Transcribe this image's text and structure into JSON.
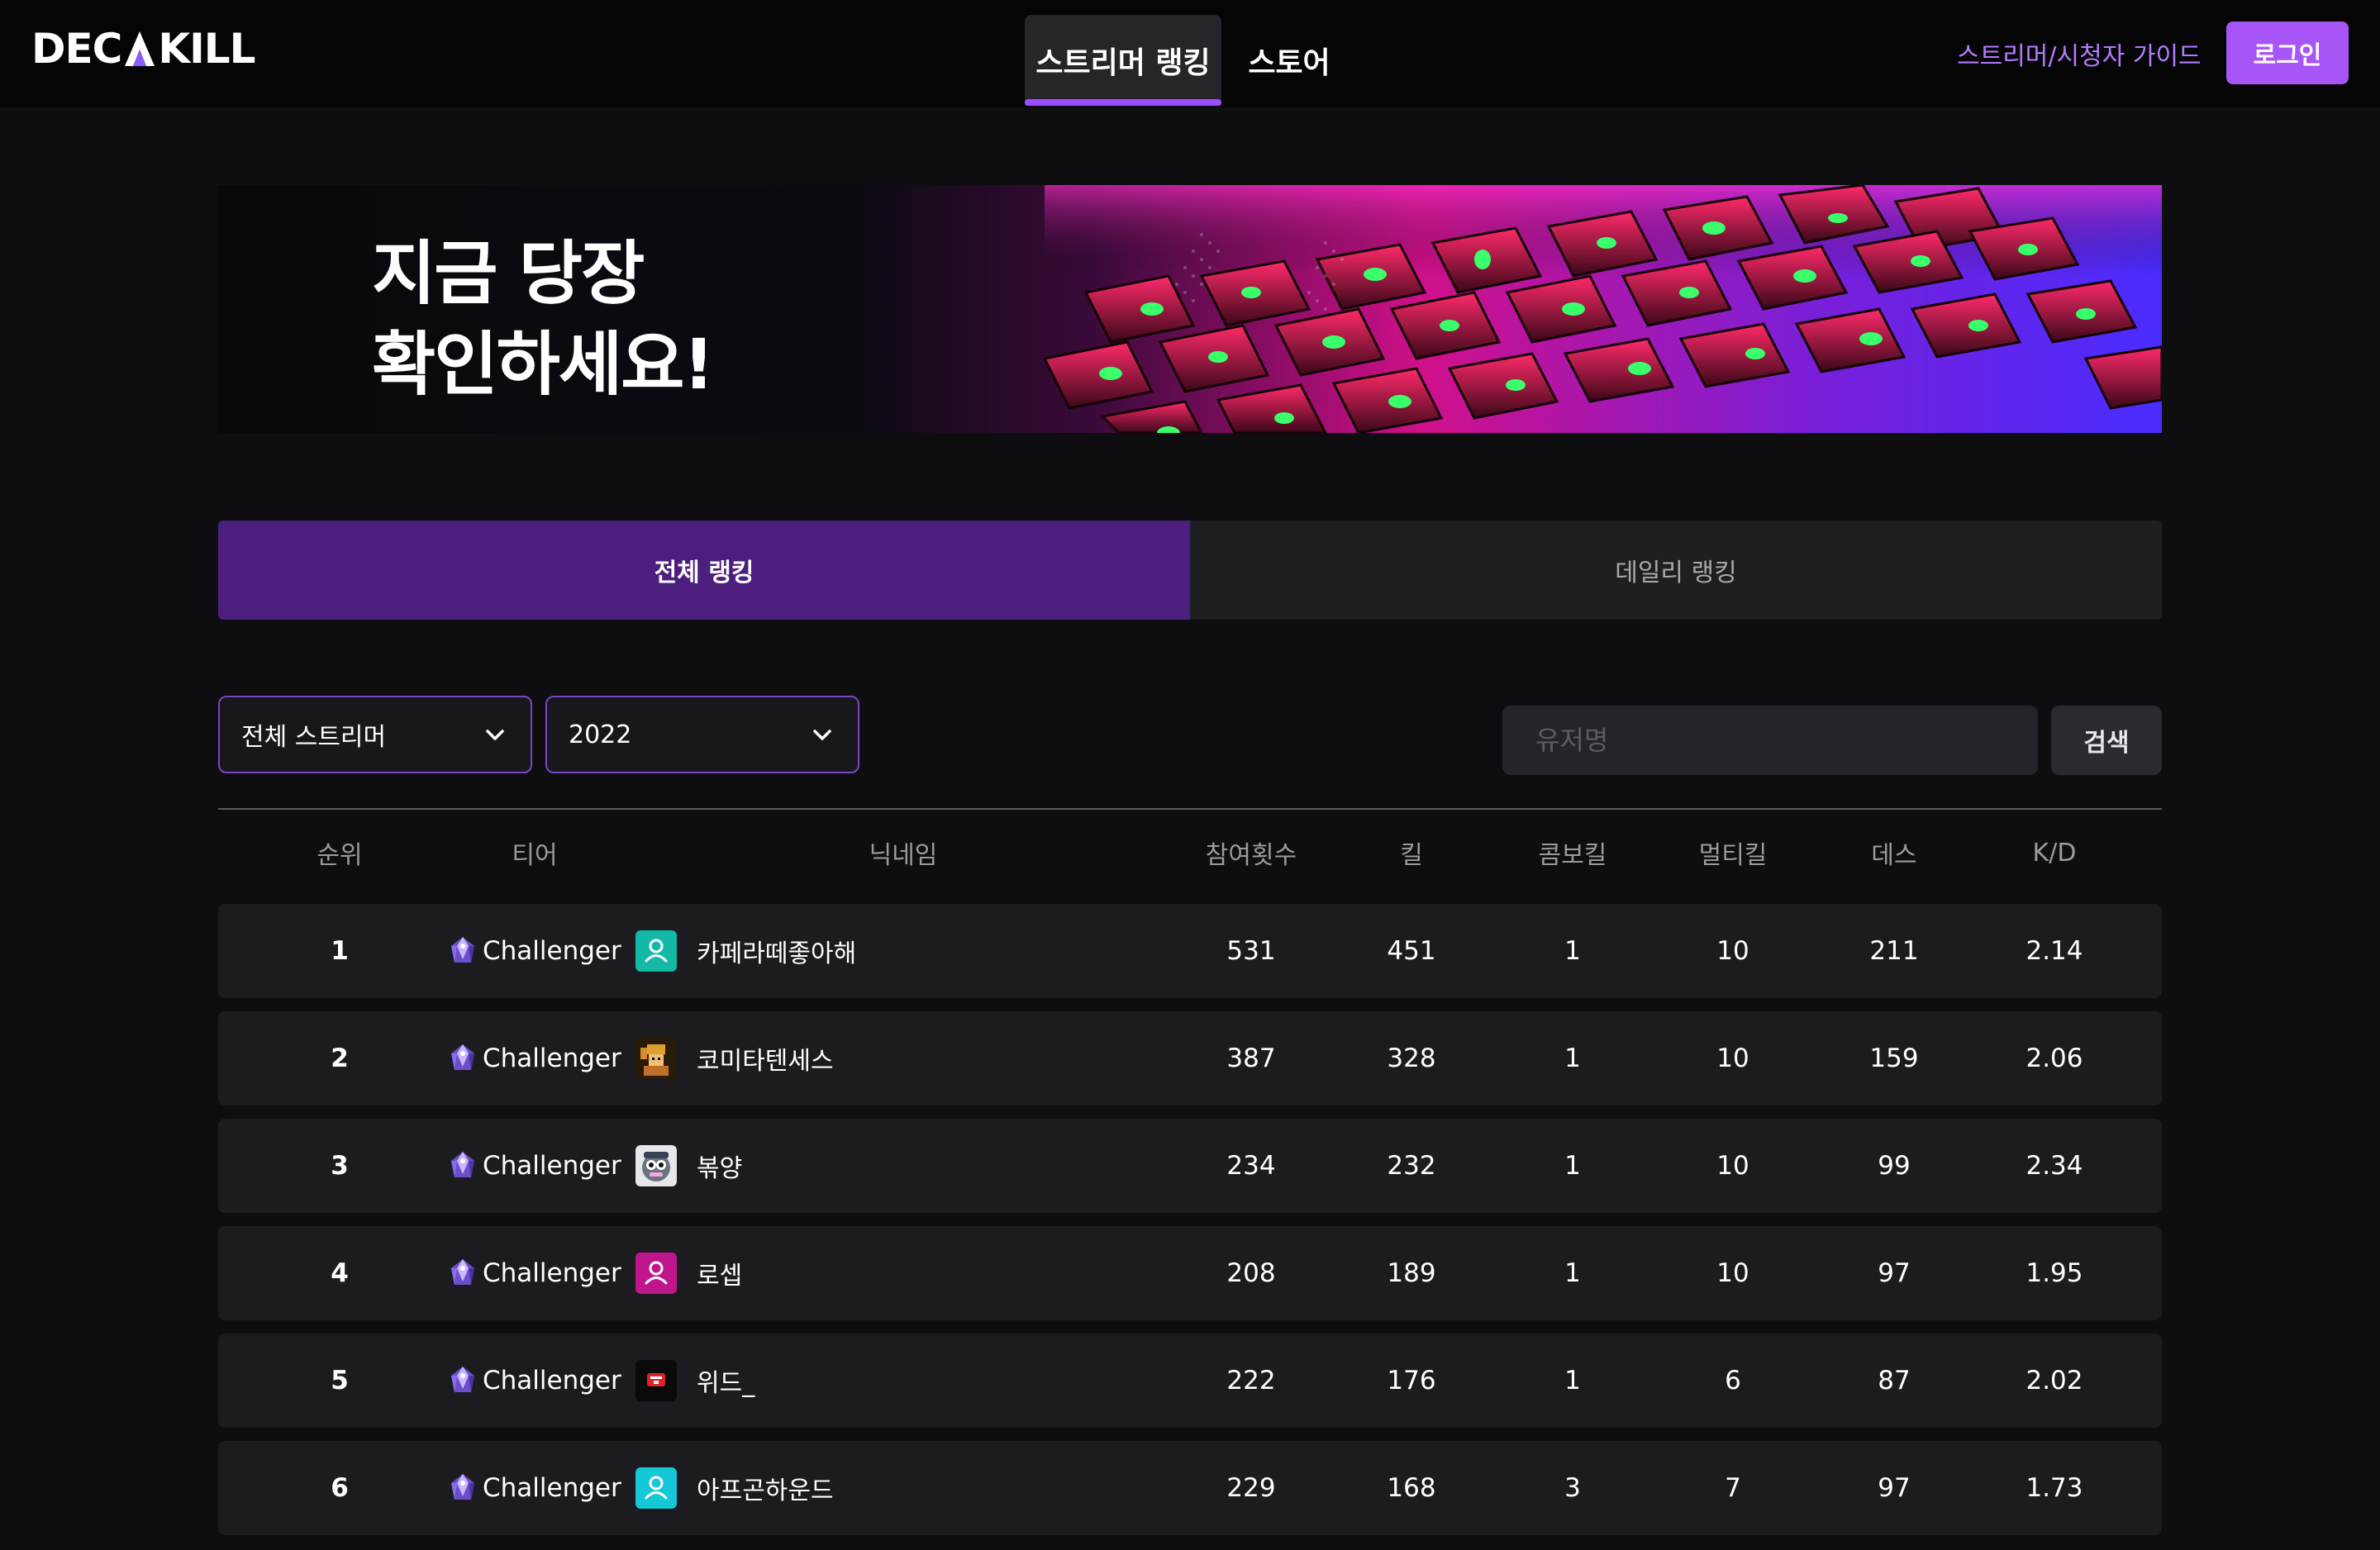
{
  "nav": {
    "logo": "DECAKILL",
    "tabs": [
      {
        "label": "스트리머 랭킹",
        "active": true
      },
      {
        "label": "스토어",
        "active": false
      }
    ],
    "guide_link": "스트리머/시청자 가이드",
    "login_label": "로그인"
  },
  "banner": {
    "line1": "지금 당장",
    "line2": "확인하세요!"
  },
  "rank_tabs": [
    {
      "label": "전체 랭킹",
      "active": true
    },
    {
      "label": "데일리 랭킹",
      "active": false
    }
  ],
  "filters": {
    "streamer_select": "전체 스트리머",
    "year_select": "2022",
    "search_placeholder": "유저명",
    "search_button": "검색"
  },
  "table": {
    "headers": [
      "순위",
      "티어",
      "닉네임",
      "참여횟수",
      "킬",
      "콤보킬",
      "멀티킬",
      "데스",
      "K/D"
    ],
    "rows": [
      {
        "rank": "1",
        "tier": "Challenger",
        "nickname": "카페라떼좋아해",
        "avatar": "person-icon",
        "avatar_color": "#14b8a6",
        "games": "531",
        "kills": "451",
        "combo": "1",
        "multi": "10",
        "deaths": "211",
        "kd": "2.14"
      },
      {
        "rank": "2",
        "tier": "Challenger",
        "nickname": "코미타텐세스",
        "avatar": "pixel-character-icon",
        "avatar_color": "#c98a2a",
        "games": "387",
        "kills": "328",
        "combo": "1",
        "multi": "10",
        "deaths": "159",
        "kd": "2.06"
      },
      {
        "rank": "3",
        "tier": "Challenger",
        "nickname": "볶양",
        "avatar": "cartoon-face-icon",
        "avatar_color": "#e5e7eb",
        "games": "234",
        "kills": "232",
        "combo": "1",
        "multi": "10",
        "deaths": "99",
        "kd": "2.34"
      },
      {
        "rank": "4",
        "tier": "Challenger",
        "nickname": "로셉",
        "avatar": "person-icon",
        "avatar_color": "#c0168c",
        "games": "208",
        "kills": "189",
        "combo": "1",
        "multi": "10",
        "deaths": "97",
        "kd": "1.95"
      },
      {
        "rank": "5",
        "tier": "Challenger",
        "nickname": "위드_",
        "avatar": "red-logo-icon",
        "avatar_color": "#0a0a0a",
        "games": "222",
        "kills": "176",
        "combo": "1",
        "multi": "6",
        "deaths": "87",
        "kd": "2.02"
      },
      {
        "rank": "6",
        "tier": "Challenger",
        "nickname": "아프곤하운드",
        "avatar": "person-icon",
        "avatar_color": "#14c8d8",
        "games": "229",
        "kills": "168",
        "combo": "3",
        "multi": "7",
        "deaths": "97",
        "kd": "1.73"
      }
    ]
  }
}
